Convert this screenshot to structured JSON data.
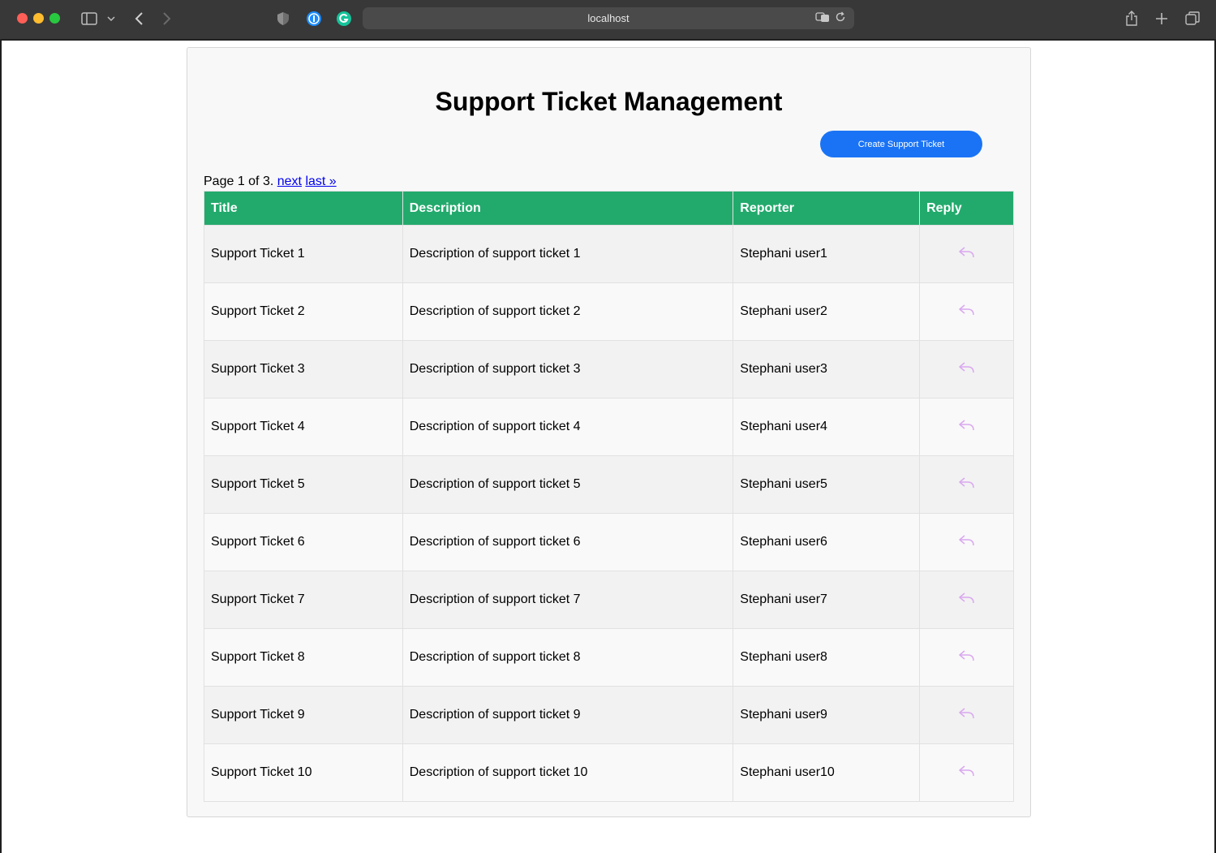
{
  "browser": {
    "url": "localhost"
  },
  "page": {
    "title": "Support Ticket Management",
    "create_button_label": "Create Support Ticket",
    "pager": {
      "text": "Page 1 of 3.",
      "next_label": "next",
      "last_label": "last »"
    }
  },
  "colors": {
    "header_green": "#22aa6c",
    "button_blue": "#1a73f5",
    "link_blue": "#0000ee",
    "reply_icon": "#d9a8ef"
  },
  "table": {
    "columns": [
      "Title",
      "Description",
      "Reporter",
      "Reply"
    ],
    "rows": [
      {
        "title": "Support Ticket 1",
        "description": "Description of support ticket 1",
        "reporter": "Stephani user1"
      },
      {
        "title": "Support Ticket 2",
        "description": "Description of support ticket 2",
        "reporter": "Stephani user2"
      },
      {
        "title": "Support Ticket 3",
        "description": "Description of support ticket 3",
        "reporter": "Stephani user3"
      },
      {
        "title": "Support Ticket 4",
        "description": "Description of support ticket 4",
        "reporter": "Stephani user4"
      },
      {
        "title": "Support Ticket 5",
        "description": "Description of support ticket 5",
        "reporter": "Stephani user5"
      },
      {
        "title": "Support Ticket 6",
        "description": "Description of support ticket 6",
        "reporter": "Stephani user6"
      },
      {
        "title": "Support Ticket 7",
        "description": "Description of support ticket 7",
        "reporter": "Stephani user7"
      },
      {
        "title": "Support Ticket 8",
        "description": "Description of support ticket 8",
        "reporter": "Stephani user8"
      },
      {
        "title": "Support Ticket 9",
        "description": "Description of support ticket 9",
        "reporter": "Stephani user9"
      },
      {
        "title": "Support Ticket 10",
        "description": "Description of support ticket 10",
        "reporter": "Stephani user10"
      }
    ]
  }
}
